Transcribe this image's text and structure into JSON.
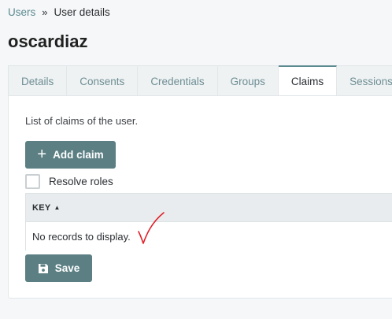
{
  "breadcrumb": {
    "parent": "Users",
    "separator": "»",
    "current": "User details"
  },
  "page": {
    "title": "oscardiaz"
  },
  "tabs": [
    {
      "label": "Details",
      "active": false
    },
    {
      "label": "Consents",
      "active": false
    },
    {
      "label": "Credentials",
      "active": false
    },
    {
      "label": "Groups",
      "active": false
    },
    {
      "label": "Claims",
      "active": true
    },
    {
      "label": "Sessions",
      "active": false
    }
  ],
  "claims": {
    "description": "List of claims of the user.",
    "add_button": "Add claim",
    "resolve_roles_label": "Resolve roles",
    "resolve_roles_checked": false,
    "table": {
      "column_key": "KEY",
      "empty_text": "No records to display."
    },
    "save_button": "Save"
  },
  "colors": {
    "accent": "#5b8a91",
    "button": "#5b7f83",
    "annotation": "#e0202a"
  },
  "icons": {
    "add": "plus-icon",
    "save": "floppy-disk-icon",
    "sort": "sort-asc-icon"
  }
}
